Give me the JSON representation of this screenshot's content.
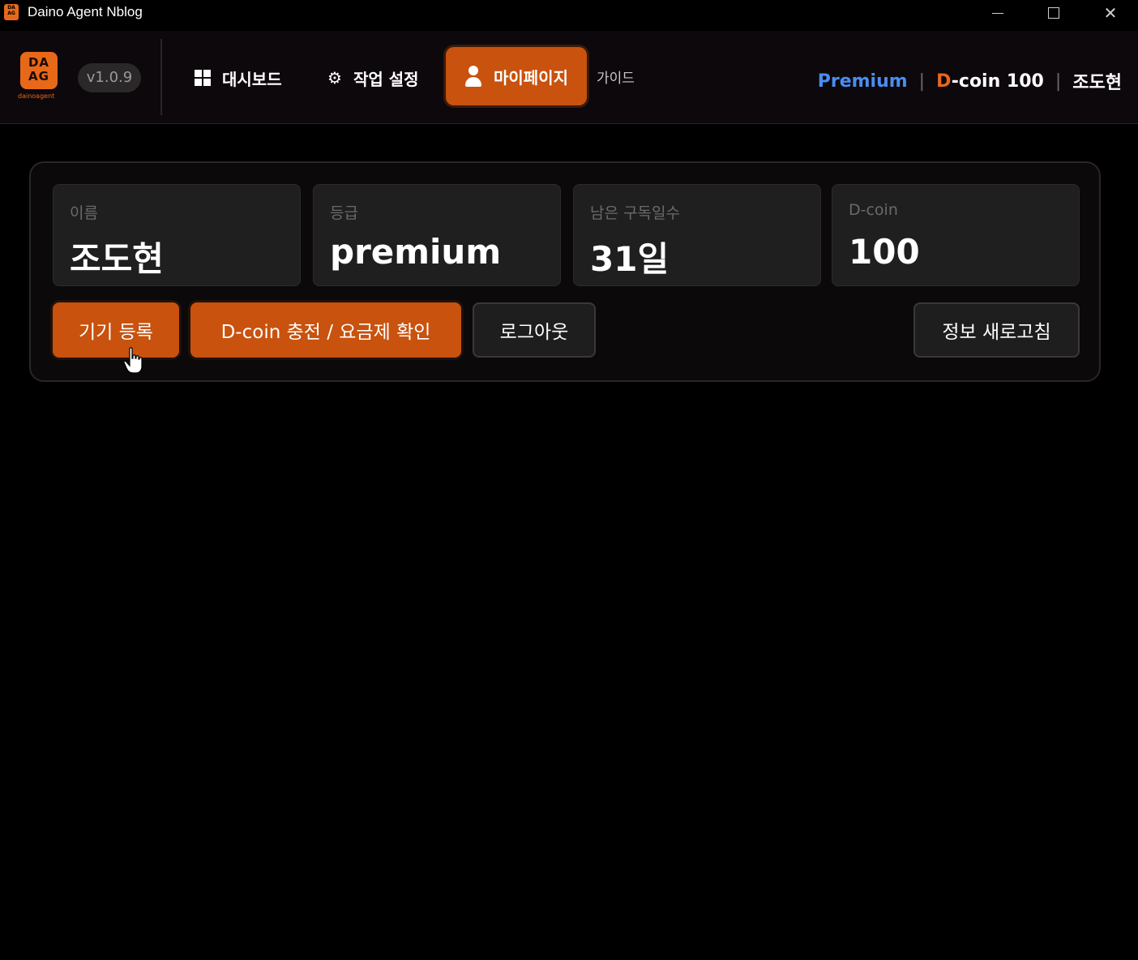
{
  "window": {
    "title": "Daino Agent Nblog",
    "icon_text": "DA AG",
    "controls": [
      "minimize",
      "maximize",
      "close"
    ]
  },
  "header": {
    "logo_text": "DA AG",
    "logo_subtext": "dainoagent",
    "version": "v1.0.9",
    "nav": {
      "dashboard": "대시보드",
      "task_settings": "작업 설정",
      "mypage": "마이페이지",
      "guide": "가이드"
    },
    "status": {
      "plan": "Premium",
      "dcoin_prefix": "D",
      "dcoin_rest": "-coin 100",
      "user": "조도현"
    }
  },
  "profile": {
    "name_label": "이름",
    "name_value": "조도현",
    "grade_label": "등급",
    "grade_value": "premium",
    "days_label": "남은 구독일수",
    "days_value": "31일",
    "dcoin_label": "D-coin",
    "dcoin_value": "100"
  },
  "actions": {
    "register_device": "기기 등록",
    "charge": "D-coin 충전 / 요금제 확인",
    "logout": "로그아웃",
    "refresh": "정보 새로고침"
  },
  "colors": {
    "accent": "#c8520e",
    "premium": "#4a8df0",
    "background": "#000000"
  }
}
